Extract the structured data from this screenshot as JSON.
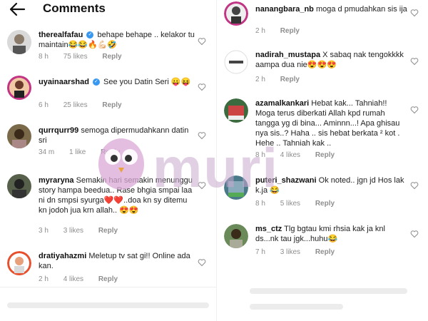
{
  "header": {
    "title": "Comments"
  },
  "left_comments": [
    {
      "user": "therealfafau",
      "verified": true,
      "text": "behape behape .. kelakor tu maintain😂😂🔥💪🏻🤣",
      "time": "8 h",
      "likes": "75 likes",
      "reply": "Reply"
    },
    {
      "user": "uyainaarshad",
      "verified": true,
      "text": "See you Datin Seri 😛😝",
      "time": "6 h",
      "likes": "25 likes",
      "reply": "Reply"
    },
    {
      "user": "qurrqurr99",
      "verified": false,
      "text": "semoga dipermudahkann datin sri",
      "time": "34 m",
      "likes": "1 like",
      "reply": "Reply"
    },
    {
      "user": "myraryna",
      "verified": false,
      "text": "Semakin hari semakin menunggu story hampa beedua.. Rase bhgia smpai laa ni dn smpsi syurga❤️❤️..doa kn sy ditemu kn jodoh jua krn allah.. 😍😍",
      "time": "3 h",
      "likes": "3 likes",
      "reply": "Reply"
    },
    {
      "user": "dratiyahazmi",
      "verified": false,
      "text": "Meletup tv sat gi!! Online ada kan.",
      "time": "2 h",
      "likes": "4 likes",
      "reply": "Reply"
    }
  ],
  "right_comments": [
    {
      "user": "nanangbara_nb",
      "text": "moga d pmudahkan sis ija",
      "time": "2 h",
      "likes": "",
      "reply": "Reply"
    },
    {
      "user": "nadirah_mustapa",
      "text": "X sabaq nak tengokkkk aampa dua nie😍😍😍",
      "time": "2 h",
      "likes": "",
      "reply": "Reply"
    },
    {
      "user": "azamalkankari",
      "text": "Hebat kak... Tahniah!! Moga terus diberkati Allah kpd rumah tangga yg di bina... Aminnn...! Apa ghisau nya sis..? Haha .. sis hebat berkata ² kot . Hehe .. Tahniah kak ..",
      "time": "8 h",
      "likes": "4 likes",
      "reply": "Reply"
    },
    {
      "user": "puteri_shazwani",
      "text": "Ok noted.. jgn jd Hos lak k.ja 😂",
      "time": "8 h",
      "likes": "5 likes",
      "reply": "Reply"
    },
    {
      "user": "ms_ctz",
      "text": "Tlg bgtau kmi rhsia kak ja knl ds...nk tau jgk...huhu😂",
      "time": "7 h",
      "likes": "3 likes",
      "reply": "Reply"
    }
  ],
  "watermark": {
    "text": "muri"
  },
  "colors": {
    "verified": "#3897f0",
    "meta": "#8e8e8e",
    "watermark": "#c9a9cf"
  }
}
